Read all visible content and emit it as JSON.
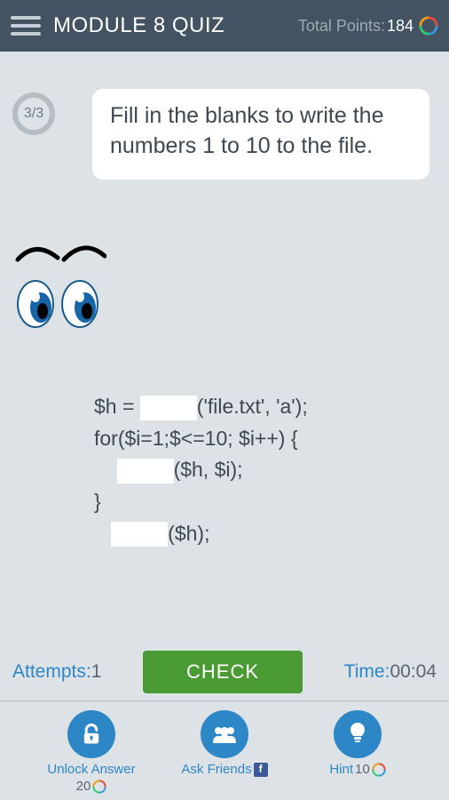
{
  "header": {
    "title": "MODULE 8 QUIZ",
    "points_label": "Total Points:",
    "points_value": "184"
  },
  "progress": "3/3",
  "question": "Fill in the blanks to write the numbers 1 to 10 to the file.",
  "code": {
    "line1_pre": "$h = ",
    "line1_post": "('file.txt', 'a');",
    "line2": "for($i=1;$<=10; $i++)  {",
    "line3_pre": "    ",
    "line3_post": "($h, $i);",
    "line4": "}",
    "line5_pre": "   ",
    "line5_post": "($h);"
  },
  "attempts": {
    "label": "Attempts:",
    "value": "1"
  },
  "check_label": "CHECK",
  "time": {
    "label": "Time:",
    "value": "00:04"
  },
  "footer": {
    "unlock": {
      "label": "Unlock Answer",
      "cost": "20"
    },
    "ask": {
      "label": "Ask Friends"
    },
    "hint": {
      "label": "Hint",
      "cost": "10"
    }
  }
}
